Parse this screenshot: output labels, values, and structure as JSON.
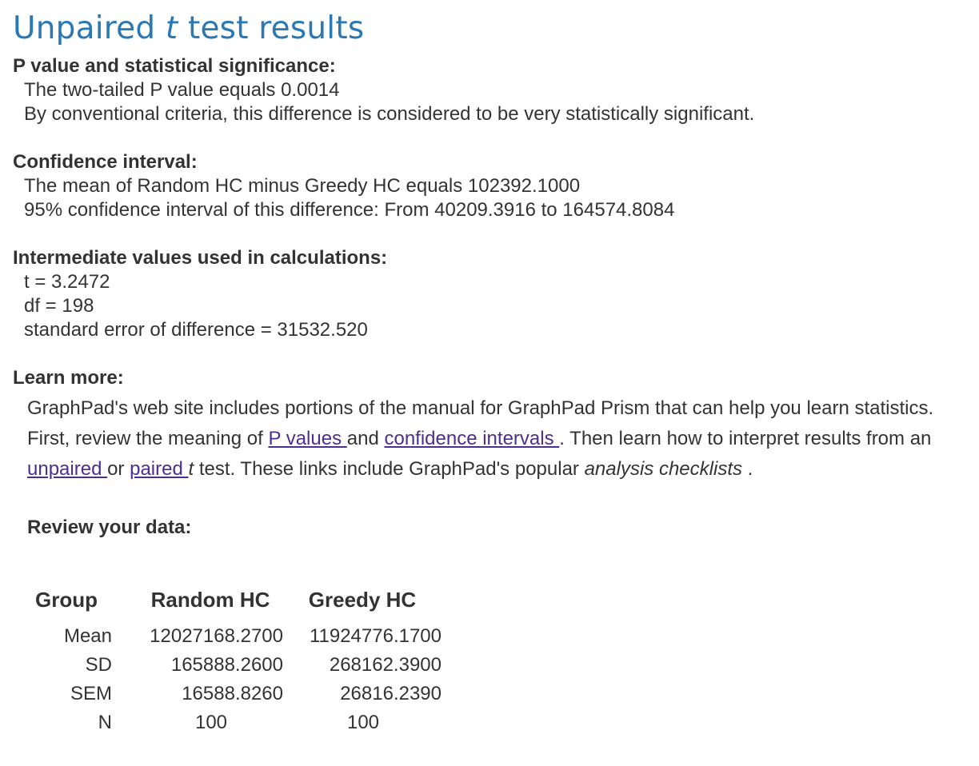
{
  "title": {
    "prefix": "Unpaired",
    "italic": "t",
    "suffix": "test results"
  },
  "p_value_section": {
    "heading": "P value and statistical significance:",
    "line1": "The two-tailed P value equals 0.0014",
    "line2": "By conventional criteria, this difference is considered to be very statistically significant."
  },
  "confidence_section": {
    "heading": "Confidence interval:",
    "line1": "The mean of Random HC minus Greedy HC equals 102392.1000",
    "line2": "95% confidence interval of this difference: From 40209.3916 to 164574.8084"
  },
  "intermediate_section": {
    "heading": "Intermediate values used in calculations:",
    "t_line": "t = 3.2472",
    "df_line": "df = 198",
    "se_line": "standard error of difference = 31532.520"
  },
  "learn_section": {
    "heading": "Learn more:",
    "text1": "GraphPad's web site includes portions of the manual for GraphPad Prism that can help you learn statistics. First, review the meaning of ",
    "link_p_values": "P values ",
    "text2": "and ",
    "link_confidence": "confidence intervals ",
    "text3": ". Then learn how to interpret results from an ",
    "link_unpaired": "unpaired ",
    "text4": "or ",
    "link_paired": "paired ",
    "link_paired_t": "t",
    "text5": " test. These links include GraphPad's popular ",
    "italic_checklists": "analysis checklists",
    "text6": " ."
  },
  "review": {
    "heading": "Review your data:",
    "table": {
      "headers": [
        "Group",
        "Random HC",
        "Greedy HC"
      ],
      "rows": [
        [
          "Mean",
          "12027168.2700",
          "11924776.1700"
        ],
        [
          "SD",
          "165888.2600",
          "268162.3900"
        ],
        [
          "SEM",
          "16588.8260",
          "26816.2390"
        ],
        [
          "N",
          "100",
          "100"
        ]
      ]
    }
  },
  "colors": {
    "title": "#2a79b5",
    "text": "#333333",
    "link": "#4b2f8f"
  }
}
